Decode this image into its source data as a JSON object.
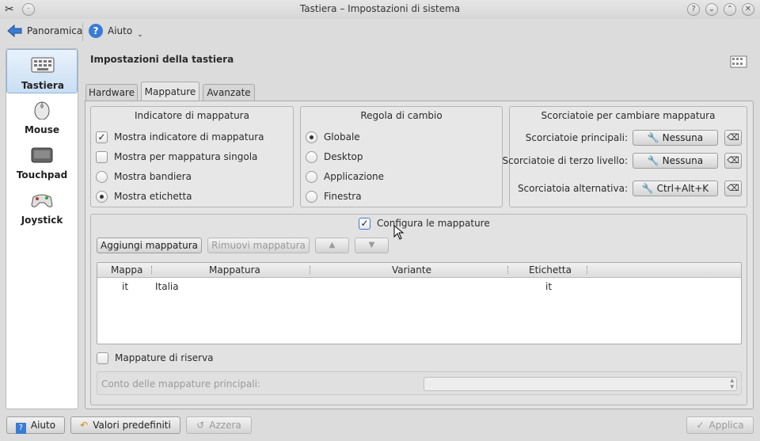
{
  "window": {
    "title": "Tastiera – Impostazioni di sistema"
  },
  "toolbar": {
    "overview_label": "Panoramica",
    "help_label": "Aiuto"
  },
  "sidebar": {
    "items": [
      {
        "label": "Tastiera"
      },
      {
        "label": "Mouse"
      },
      {
        "label": "Touchpad"
      },
      {
        "label": "Joystick"
      }
    ]
  },
  "page": {
    "heading": "Impostazioni della tastiera"
  },
  "tabs": [
    {
      "label": "Hardware"
    },
    {
      "label": "Mappature"
    },
    {
      "label": "Avanzate"
    }
  ],
  "indicator": {
    "title": "Indicatore di mappatura",
    "options": [
      {
        "label": "Mostra indicatore di mappatura",
        "checked": true
      },
      {
        "label": "Mostra per mappatura singola",
        "checked": false
      },
      {
        "label": "Mostra bandiera",
        "selected": false
      },
      {
        "label": "Mostra etichetta",
        "selected": true
      }
    ]
  },
  "switching": {
    "title": "Regola di cambio",
    "options": [
      {
        "label": "Globale",
        "selected": true
      },
      {
        "label": "Desktop",
        "selected": false
      },
      {
        "label": "Applicazione",
        "selected": false
      },
      {
        "label": "Finestra",
        "selected": false
      }
    ]
  },
  "shortcuts": {
    "title": "Scorciatoie per cambiare mappatura",
    "rows": [
      {
        "label": "Scorciatoie principali:",
        "value": "Nessuna"
      },
      {
        "label": "Scorciatoie di terzo livello:",
        "value": "Nessuna"
      },
      {
        "label": "Scorciatoia alternativa:",
        "value": "Ctrl+Alt+K"
      }
    ]
  },
  "layouts": {
    "configure_label": "Configura le mappature",
    "configure_checked": true,
    "add_label": "Aggiungi mappatura",
    "remove_label": "Rimuovi mappatura",
    "columns": [
      "Mappa",
      "Mappatura",
      "Variante",
      "Etichetta"
    ],
    "rows": [
      {
        "map": "it",
        "layout": "Italia",
        "variant": "",
        "label": "it"
      }
    ],
    "spare_label": "Mappature di riserva",
    "spare_checked": false,
    "main_count_label": "Conto delle mappature principali:"
  },
  "footer": {
    "help": "Aiuto",
    "defaults": "Valori predefiniti",
    "reset": "Azzera",
    "apply": "Applica"
  },
  "colors": {
    "accent": "#3a7bd5",
    "selection": "#c9def3"
  }
}
